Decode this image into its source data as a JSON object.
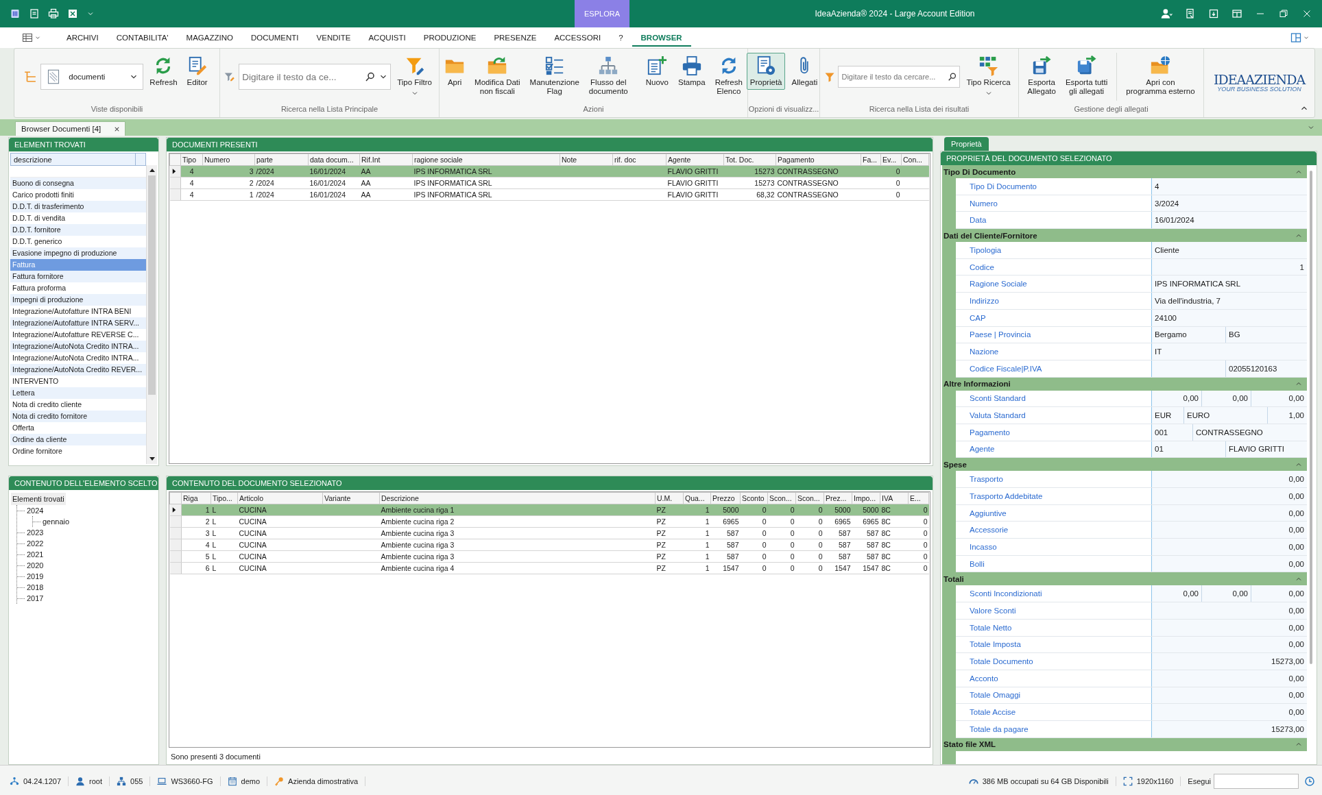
{
  "title_bar": {
    "mode": "ESPLORA",
    "title": "IdeaAzienda® 2024 - Large Account Edition"
  },
  "menu": [
    {
      "label": "ARCHIVI",
      "selected": false
    },
    {
      "label": "CONTABILITA'",
      "selected": false
    },
    {
      "label": "MAGAZZINO",
      "selected": false
    },
    {
      "label": "DOCUMENTI",
      "selected": false
    },
    {
      "label": "VENDITE",
      "selected": false
    },
    {
      "label": "ACQUISTI",
      "selected": false
    },
    {
      "label": "PRODUZIONE",
      "selected": false
    },
    {
      "label": "PRESENZE",
      "selected": false
    },
    {
      "label": "ACCESSORI",
      "selected": false
    },
    {
      "label": "?",
      "selected": false
    },
    {
      "label": "BROWSER",
      "selected": true
    }
  ],
  "ribbon": {
    "groups": [
      {
        "caption": "Viste disponibili",
        "items": [
          {
            "kind": "icon"
          },
          {
            "kind": "dropdown",
            "value": "documenti"
          },
          {
            "kind": "button",
            "label": "Refresh"
          },
          {
            "kind": "button",
            "label": "Editor"
          }
        ]
      },
      {
        "caption": "Ricerca nella Lista Principale",
        "items": [
          {
            "kind": "search-large",
            "placeholder": "Digitare il testo da ce..."
          },
          {
            "kind": "button",
            "label": "Tipo Filtro",
            "menu": true
          }
        ]
      },
      {
        "caption": "Azioni",
        "items": [
          {
            "kind": "button",
            "label": "Apri"
          },
          {
            "kind": "button",
            "label": "Modifica Dati\nnon fiscali"
          },
          {
            "kind": "button",
            "label": "Manutenzione\nFlag"
          },
          {
            "kind": "button",
            "label": "Flusso del\ndocumento"
          },
          {
            "kind": "separator"
          },
          {
            "kind": "button",
            "label": "Nuovo"
          },
          {
            "kind": "button",
            "label": "Stampa"
          },
          {
            "kind": "button",
            "label": "Refresh\nElenco"
          }
        ]
      },
      {
        "caption": "Opzioni di visualizz...",
        "items": [
          {
            "kind": "toggle",
            "label": "Proprietà",
            "selected": true
          },
          {
            "kind": "toggle",
            "label": "Allegati",
            "selected": false
          }
        ]
      },
      {
        "caption": "Ricerca nella Lista dei risultati",
        "items": [
          {
            "kind": "search",
            "placeholder": "Digitare il testo da cercare..."
          },
          {
            "kind": "button",
            "label": "Tipo Ricerca",
            "menu": true
          }
        ]
      },
      {
        "caption": "Gestione degli allegati",
        "items": [
          {
            "kind": "button",
            "label": "Esporta\nAllegato"
          },
          {
            "kind": "button",
            "label": "Esporta tutti\ngli allegati"
          },
          {
            "kind": "separator"
          },
          {
            "kind": "button",
            "label": "Apri con\nprogramma esterno"
          }
        ]
      }
    ],
    "logo": {
      "name": "IDEAAZIENDA",
      "tagline": "YOUR BUSINESS SOLUTION"
    }
  },
  "document_tab": {
    "label": "Browser Documenti [4]"
  },
  "elements": {
    "title": "ELEMENTI TROVATI",
    "column": "descrizione",
    "items": [
      {
        "label": "Buono di consegna",
        "selected": false
      },
      {
        "label": "Carico prodotti finiti",
        "selected": false
      },
      {
        "label": "D.D.T. di trasferimento",
        "selected": false
      },
      {
        "label": "D.D.T. di vendita",
        "selected": false
      },
      {
        "label": "D.D.T. fornitore",
        "selected": false
      },
      {
        "label": "D.D.T. generico",
        "selected": false
      },
      {
        "label": "Evasione impegno di produzione",
        "selected": false
      },
      {
        "label": "Fattura",
        "selected": true
      },
      {
        "label": "Fattura fornitore",
        "selected": false
      },
      {
        "label": "Fattura proforma",
        "selected": false
      },
      {
        "label": "Impegni di produzione",
        "selected": false
      },
      {
        "label": "Integrazione/Autofatture INTRA BENI",
        "selected": false
      },
      {
        "label": "Integrazione/Autofatture INTRA SERV...",
        "selected": false
      },
      {
        "label": "Integrazione/Autofatture REVERSE C...",
        "selected": false
      },
      {
        "label": "Integrazione/AutoNota Credito INTRA...",
        "selected": false
      },
      {
        "label": "Integrazione/AutoNota Credito INTRA...",
        "selected": false
      },
      {
        "label": "Integrazione/AutoNota Credito REVER...",
        "selected": false
      },
      {
        "label": "INTERVENTO",
        "selected": false
      },
      {
        "label": "Lettera",
        "selected": false
      },
      {
        "label": "Nota di credito cliente",
        "selected": false
      },
      {
        "label": "Nota di credito fornitore",
        "selected": false
      },
      {
        "label": "Offerta",
        "selected": false
      },
      {
        "label": "Ordine da cliente",
        "selected": false
      },
      {
        "label": "Ordine fornitore",
        "selected": false
      }
    ]
  },
  "tree": {
    "title": "CONTENUTO DELL'ELEMENTO SCELTO",
    "root": "Elementi trovati",
    "children": [
      {
        "label": "2024",
        "children": [
          {
            "label": "gennaio"
          }
        ]
      },
      {
        "label": "2023"
      },
      {
        "label": "2022"
      },
      {
        "label": "2021"
      },
      {
        "label": "2020"
      },
      {
        "label": "2019"
      },
      {
        "label": "2018"
      },
      {
        "label": "2017"
      }
    ]
  },
  "documents": {
    "title": "DOCUMENTI PRESENTI",
    "columns": [
      "Tipo",
      "Numero",
      "parte",
      "data docum...",
      "Rif.Int",
      "ragione sociale",
      "Note",
      "rif. doc",
      "Agente",
      "Tot. Doc.",
      "Pagamento",
      "Fa...",
      "Ev...",
      "Con..."
    ],
    "rows": [
      {
        "selected": true,
        "cells": [
          "4",
          "3",
          "/2024",
          "16/01/2024",
          "AA",
          "IPS INFORMATICA SRL",
          null,
          null,
          "FLAVIO GRITTI",
          "15273",
          "CONTRASSEGNO",
          null,
          "0",
          null
        ]
      },
      {
        "selected": false,
        "cells": [
          "4",
          "2",
          "/2024",
          "16/01/2024",
          "AA",
          "IPS INFORMATICA SRL",
          null,
          null,
          "FLAVIO GRITTI",
          "15273",
          "CONTRASSEGNO",
          null,
          "0",
          null
        ]
      },
      {
        "selected": false,
        "cells": [
          "4",
          "1",
          "/2024",
          "16/01/2024",
          "AA",
          "IPS INFORMATICA SRL",
          null,
          null,
          "FLAVIO GRITTI",
          "68,32",
          "CONTRASSEGNO",
          null,
          "0",
          null
        ]
      }
    ]
  },
  "lines": {
    "title": "CONTENUTO DEL DOCUMENTO SELEZIONATO",
    "columns": [
      "Riga",
      "Tipo...",
      "Articolo",
      "Variante",
      "Descrizione",
      "U.M.",
      "Qua...",
      "Prezzo",
      "Sconto",
      "Scon...",
      "Scon...",
      "Prez...",
      "Impo...",
      "IVA",
      "E..."
    ],
    "rows": [
      {
        "selected": true,
        "cells": [
          "1",
          "L",
          "CUCINA",
          null,
          "Ambiente cucina riga 1",
          "PZ",
          "1",
          "5000",
          "0",
          "0",
          "0",
          "5000",
          "5000",
          "8C",
          "0"
        ]
      },
      {
        "selected": false,
        "cells": [
          "2",
          "L",
          "CUCINA",
          null,
          "Ambiente cucina riga 2",
          "PZ",
          "1",
          "6965",
          "0",
          "0",
          "0",
          "6965",
          "6965",
          "8C",
          "0"
        ]
      },
      {
        "selected": false,
        "cells": [
          "3",
          "L",
          "CUCINA",
          null,
          "Ambiente cucina riga 3",
          "PZ",
          "1",
          "587",
          "0",
          "0",
          "0",
          "587",
          "587",
          "8C",
          "0"
        ]
      },
      {
        "selected": false,
        "cells": [
          "4",
          "L",
          "CUCINA",
          null,
          "Ambiente cucina riga 3",
          "PZ",
          "1",
          "587",
          "0",
          "0",
          "0",
          "587",
          "587",
          "8C",
          "0"
        ]
      },
      {
        "selected": false,
        "cells": [
          "5",
          "L",
          "CUCINA",
          null,
          "Ambiente cucina riga 3",
          "PZ",
          "1",
          "587",
          "0",
          "0",
          "0",
          "587",
          "587",
          "8C",
          "0"
        ]
      },
      {
        "selected": false,
        "cells": [
          "6",
          "L",
          "CUCINA",
          null,
          "Ambiente cucina riga 4",
          "PZ",
          "1",
          "1547",
          "0",
          "0",
          "0",
          "1547",
          "1547",
          "8C",
          "0"
        ]
      }
    ]
  },
  "footer": "Sono presenti 3 documenti",
  "properties": {
    "tab": "Proprietà",
    "title": "PROPRIETÀ DEL DOCUMENTO SELEZIONATO",
    "sections": [
      {
        "title": "Tipo Di Documento",
        "expanded": true,
        "rows": [
          {
            "label": "Tipo Di Documento",
            "kind": "text",
            "values": [
              "4"
            ]
          },
          {
            "label": "Numero",
            "kind": "text",
            "values": [
              "3/2024"
            ]
          },
          {
            "label": "Data",
            "kind": "text",
            "values": [
              "16/01/2024"
            ]
          }
        ]
      },
      {
        "title": "Dati del Cliente/Fornitore",
        "expanded": true,
        "rows": [
          {
            "label": "Tipologia",
            "kind": "text",
            "values": [
              "Cliente"
            ]
          },
          {
            "label": "Codice",
            "kind": "amount",
            "values": [
              "1"
            ]
          },
          {
            "label": "Ragione Sociale",
            "kind": "text",
            "values": [
              "IPS INFORMATICA SRL"
            ]
          },
          {
            "label": "Indirizzo",
            "kind": "text",
            "values": [
              "Via dell'industria, 7"
            ]
          },
          {
            "label": "CAP",
            "kind": "text",
            "values": [
              "24100"
            ]
          },
          {
            "label": "Paese | Provincia",
            "kind": "halves",
            "values": [
              "Bergamo",
              "BG"
            ]
          },
          {
            "label": "Nazione",
            "kind": "text",
            "values": [
              "IT"
            ]
          },
          {
            "label": "Codice Fiscale|P.IVA",
            "kind": "half-right",
            "values": [
              "02055120163"
            ]
          }
        ]
      },
      {
        "title": "Altre Informazioni",
        "expanded": true,
        "rows": [
          {
            "label": "Sconti Standard",
            "kind": "triple",
            "values": [
              "0,00",
              "0,00",
              "0,00"
            ]
          },
          {
            "label": "Valuta Standard",
            "kind": "currency",
            "values": [
              "EUR",
              "EURO",
              "1,00"
            ]
          },
          {
            "label": "Pagamento",
            "kind": "code",
            "values": [
              "001",
              "CONTRASSEGNO"
            ]
          },
          {
            "label": "Agente",
            "kind": "halves",
            "values": [
              "01",
              "FLAVIO GRITTI"
            ]
          }
        ]
      },
      {
        "title": "Spese",
        "expanded": true,
        "rows": [
          {
            "label": "Trasporto",
            "kind": "amount",
            "values": [
              "0,00"
            ]
          },
          {
            "label": "Trasporto Addebitate",
            "kind": "amount",
            "values": [
              "0,00"
            ]
          },
          {
            "label": "Aggiuntive",
            "kind": "amount",
            "values": [
              "0,00"
            ]
          },
          {
            "label": "Accessorie",
            "kind": "amount",
            "values": [
              "0,00"
            ]
          },
          {
            "label": "Incasso",
            "kind": "amount",
            "values": [
              "0,00"
            ]
          },
          {
            "label": "Bolli",
            "kind": "amount",
            "values": [
              "0,00"
            ]
          }
        ]
      },
      {
        "title": "Totali",
        "expanded": true,
        "rows": [
          {
            "label": "Sconti Incondizionati",
            "kind": "triple",
            "values": [
              "0,00",
              "0,00",
              "0,00"
            ]
          },
          {
            "label": "Valore Sconti",
            "kind": "amount",
            "values": [
              "0,00"
            ]
          },
          {
            "label": "Totale Netto",
            "kind": "amount",
            "values": [
              "0,00"
            ]
          },
          {
            "label": "Totale Imposta",
            "kind": "amount",
            "values": [
              "0,00"
            ]
          },
          {
            "label": "Totale Documento",
            "kind": "amount",
            "values": [
              "15273,00"
            ]
          },
          {
            "label": "Acconto",
            "kind": "amount",
            "values": [
              "0,00"
            ]
          },
          {
            "label": "Totale Omaggi",
            "kind": "amount",
            "values": [
              "0,00"
            ]
          },
          {
            "label": "Totale Accise",
            "kind": "amount",
            "values": [
              "0,00"
            ]
          },
          {
            "label": "Totale da pagare",
            "kind": "amount",
            "values": [
              "15273,00"
            ]
          }
        ]
      },
      {
        "title": "Stato file XML",
        "expanded": true
      }
    ]
  },
  "status_bar": {
    "items": [
      {
        "text": "04.24.1207"
      },
      {
        "text": "root"
      },
      {
        "text": "055"
      },
      {
        "text": "WS3660-FG"
      },
      {
        "text": "demo"
      },
      {
        "text": "Azienda dimostrativa"
      }
    ],
    "memory": "386 MB occupati su 64 GB Disponibili",
    "resolution": "1920x1160",
    "run_label": "Esegui"
  }
}
